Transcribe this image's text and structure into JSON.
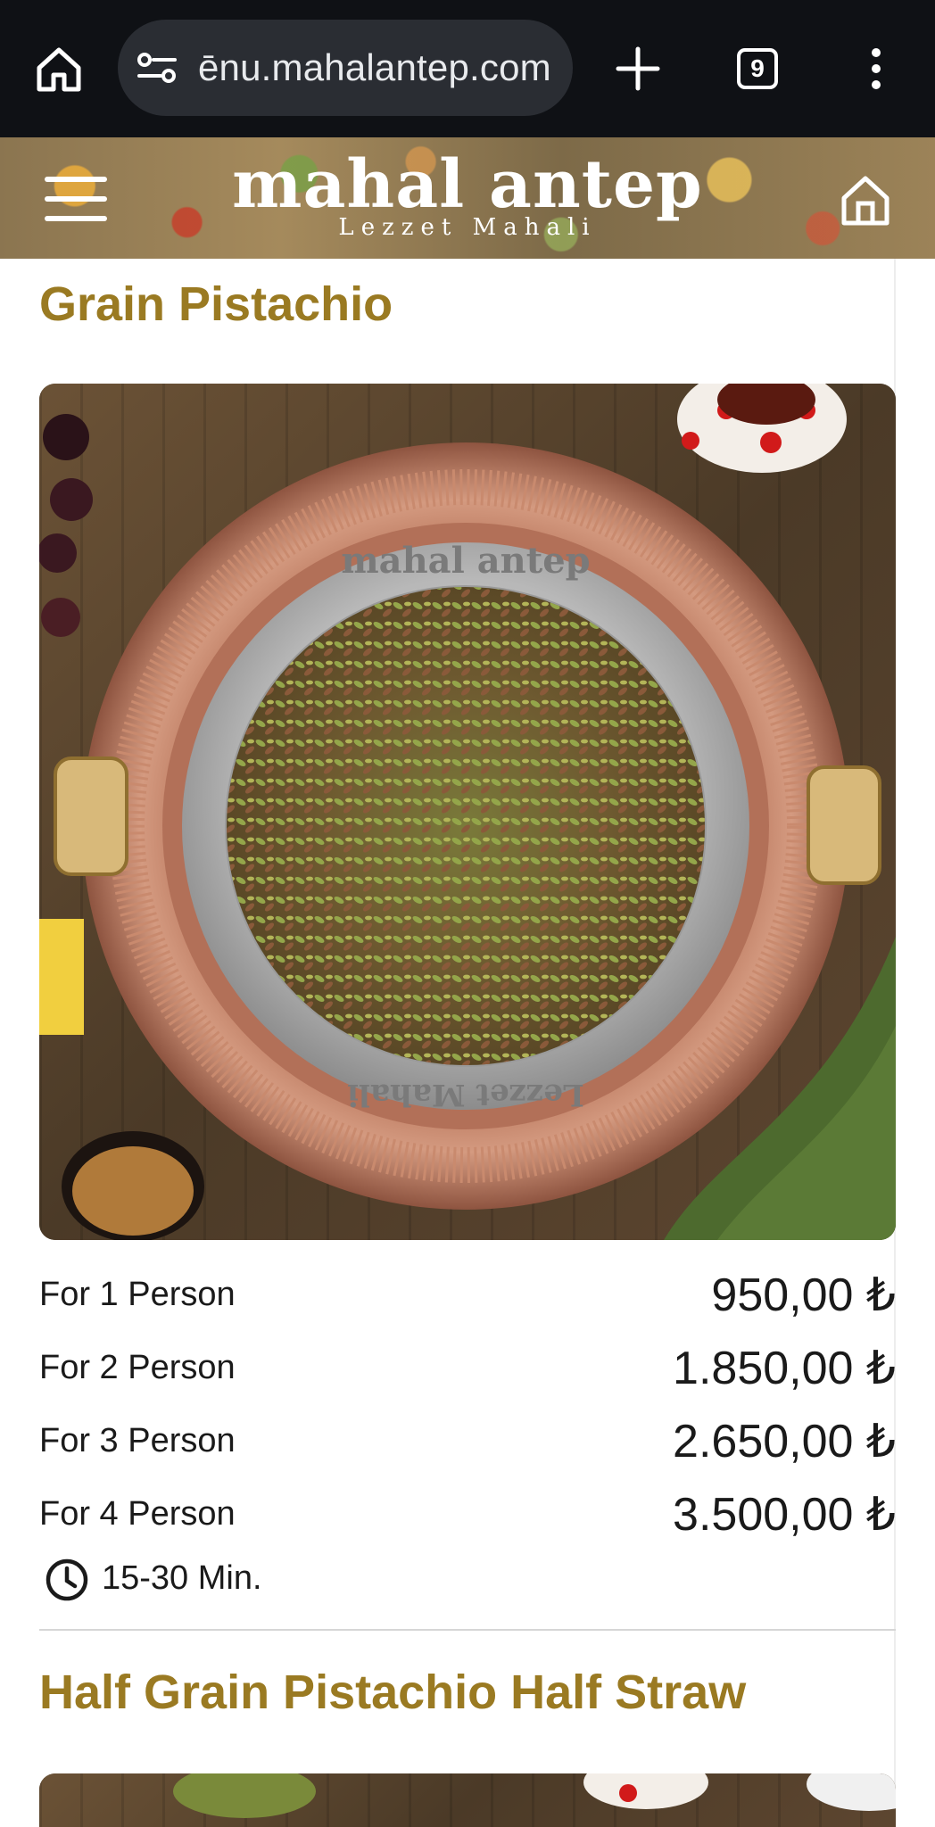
{
  "browser": {
    "url": "menu.mahalantep.com",
    "url_visible": "ēnu.mahalantep.com",
    "tab_count": "9"
  },
  "site": {
    "brand": "mahal antep",
    "tagline": "Lezzet Mahali"
  },
  "items": [
    {
      "title": "Grain Pistachio",
      "image_plate_text_top": "mahal antep",
      "image_plate_text_bottom": "Lezzet Mahali",
      "prices": [
        {
          "label": "For 1 Person",
          "price": "950,00 ₺"
        },
        {
          "label": "For 2 Person",
          "price": "1.850,00 ₺"
        },
        {
          "label": "For 3 Person",
          "price": "2.650,00 ₺"
        },
        {
          "label": "For 4 Person",
          "price": "3.500,00 ₺"
        }
      ],
      "prep_time": "15-30 Min."
    },
    {
      "title": "Half Grain Pistachio Half Straw"
    }
  ],
  "colors": {
    "title": "#9a7a22",
    "chrome_bg": "#0f1115",
    "urlbar_bg": "#2a2d33"
  }
}
